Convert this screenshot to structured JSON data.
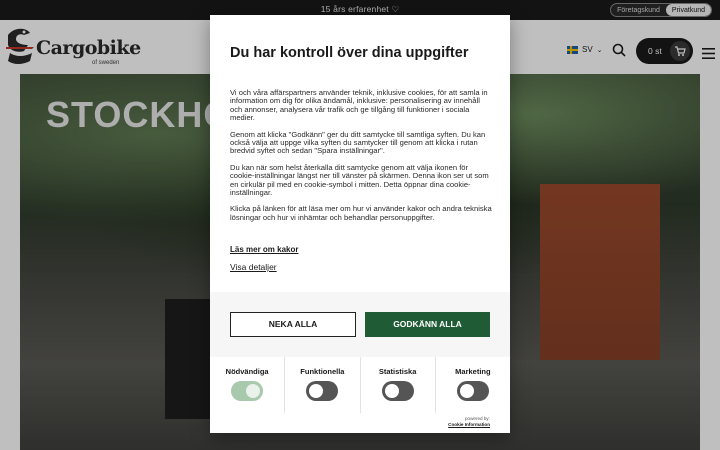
{
  "topbar": {
    "message": "15 års erfarenhet",
    "message_icon": "heart-icon",
    "segment": [
      "Företagskund",
      "Privatkund"
    ],
    "segment_active": "Privatkund"
  },
  "header": {
    "logo_text": "Cargobike",
    "logo_sub": "of sweden",
    "language": "SV",
    "cart_count": "0 st"
  },
  "hero": {
    "title": "STOCKHOLM"
  },
  "cookie_dialog": {
    "title": "Du har kontroll över dina uppgifter",
    "paragraphs": [
      "Vi och våra affärspartners använder teknik, inklusive cookies, för att samla in information om dig för olika ändamål, inklusive: personalisering av innehåll och annonser, analysera vår trafik och ge tillgång till funktioner i sociala medier.",
      "Genom att klicka \"Godkänn\" ger du ditt samtycke till samtliga syften. Du kan också välja att uppge vilka syften du samtycker till genom att klicka i rutan bredvid syftet och sedan \"Spara inställningar\".",
      "Du kan när som helst återkalla ditt samtycke genom att välja ikonen för cookie-inställningar längst ner till vänster på skärmen. Denna ikon ser ut som en cirkulär pil med en cookie-symbol i mitten. Detta öppnar dina cookie-inställningar.",
      "Klicka på länken för att läsa mer om hur vi använder kakor och andra tekniska lösningar och hur vi inhämtar och behandlar personuppgifter."
    ],
    "read_more_link": "Läs mer om kakor",
    "details_link": "Visa detaljer",
    "deny_label": "NEKA ALLA",
    "accept_label": "GODKÄNN ALLA",
    "toggles": [
      {
        "label": "Nödvändiga",
        "on": true
      },
      {
        "label": "Funktionella",
        "on": false
      },
      {
        "label": "Statistiska",
        "on": false
      },
      {
        "label": "Marketing",
        "on": false
      }
    ],
    "powered_by": "powered by:",
    "powered_name": "Cookie Information"
  },
  "colors": {
    "accept_green": "#1f5c35",
    "topbar_bg": "#1a1a1a",
    "toggle_on": "#a9c9ad"
  }
}
